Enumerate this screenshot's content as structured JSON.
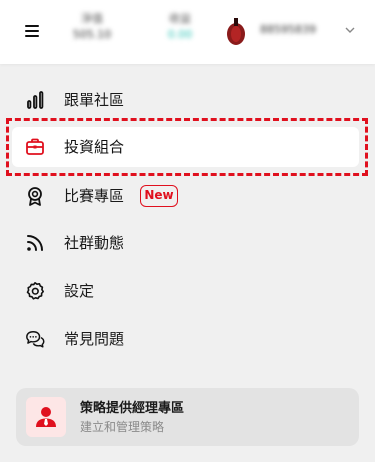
{
  "header": {
    "menu_icon": "hamburger-icon",
    "stats": [
      {
        "label": "淨值",
        "value": "505.10"
      },
      {
        "label": "收益",
        "value": "0.00"
      }
    ],
    "account_id": "88595839",
    "profit_color": "#2bc3b5"
  },
  "menu": {
    "items": [
      {
        "label": "跟單社區",
        "icon": "bar-chart-icon"
      },
      {
        "label": "投資組合",
        "icon": "briefcase-icon",
        "active": true
      },
      {
        "label": "比賽專區",
        "icon": "award-icon",
        "badge": "New"
      },
      {
        "label": "社群動態",
        "icon": "rss-icon"
      },
      {
        "label": "設定",
        "icon": "gear-icon"
      },
      {
        "label": "常見問題",
        "icon": "chat-bubbles-icon"
      }
    ]
  },
  "card": {
    "title": "策略提供經理專區",
    "subtitle": "建立和管理策略",
    "icon": "manager-icon"
  },
  "colors": {
    "accent": "#e0101e",
    "background": "#f0f0f0"
  }
}
